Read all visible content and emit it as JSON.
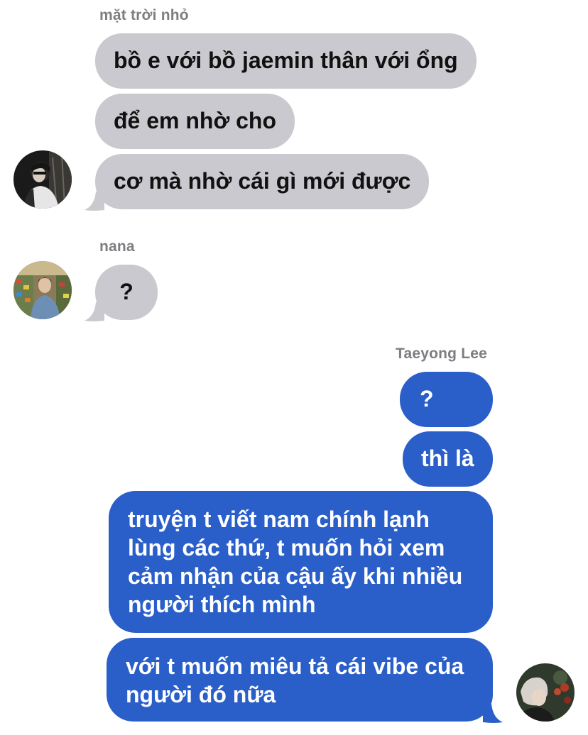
{
  "colors": {
    "incoming_bubble": "#c9c9cf",
    "outgoing_bubble": "#2a5fc9",
    "sender_name": "#7d7d82"
  },
  "groups": [
    {
      "sender": "mặt trời nhỏ",
      "avatar_icon": "user-avatar-dark-portrait",
      "messages": [
        "bồ e với bồ jaemin thân với ổng",
        "để em nhờ cho",
        "cơ mà nhờ cái gì mới được"
      ]
    },
    {
      "sender": "nana",
      "avatar_icon": "user-avatar-store-photo",
      "messages": [
        "?"
      ]
    },
    {
      "sender": "Taeyong Lee",
      "avatar_icon": "user-avatar-selfie",
      "messages": [
        "?",
        "thì là",
        "truyện t viết nam chính lạnh lùng các thứ, t muốn hỏi xem cảm nhận của cậu ấy khi nhiều người thích mình",
        "với t muốn miêu tả cái vibe của người đó nữa"
      ]
    }
  ]
}
